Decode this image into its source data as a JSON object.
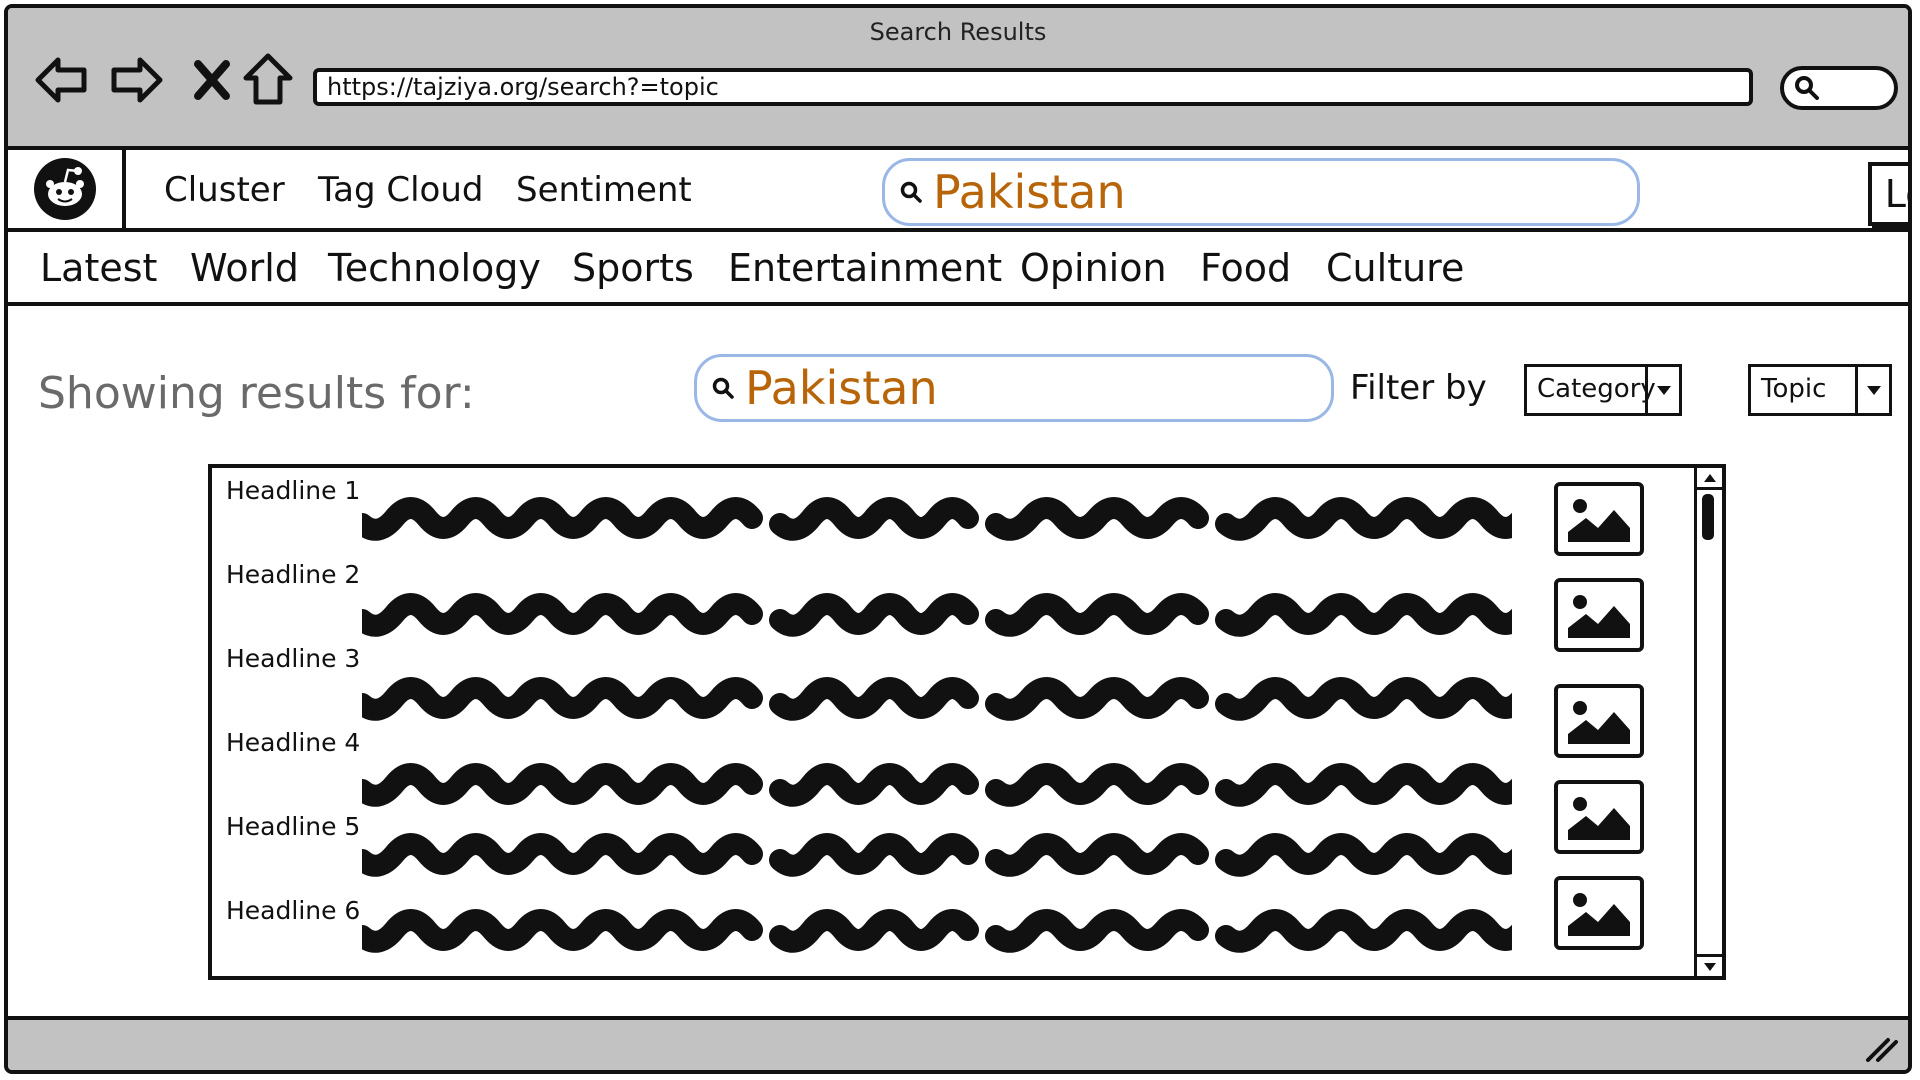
{
  "window": {
    "title": "Search Results"
  },
  "browser": {
    "url": "https://tajziya.org/search?=topic",
    "nav_icons": [
      "back-arrow-icon",
      "forward-arrow-icon",
      "close-x-icon",
      "home-icon"
    ],
    "mini_search_icon": "search-icon"
  },
  "header": {
    "logo_icon": "reddit-alien-logo",
    "links": [
      "Cluster",
      "Tag Cloud",
      "Sentiment"
    ],
    "search_value": "Pakistan",
    "login_label": "Login"
  },
  "categories": [
    "Latest",
    "World",
    "Technology",
    "Sports",
    "Entertainment",
    "Opinion",
    "Food",
    "Culture"
  ],
  "results_header": {
    "showing_label": "Showing results for:",
    "search_value": "Pakistan",
    "filter_label": "Filter by",
    "filter_category": "Category",
    "filter_topic": "Topic"
  },
  "results": {
    "headlines": [
      "Headline 1",
      "Headline 2",
      "Headline 3",
      "Headline 4",
      "Headline 5",
      "Headline 6"
    ],
    "thumbnail_icon": "image-placeholder-icon"
  },
  "colors": {
    "chrome_gray": "#c2c2c2",
    "search_text": "#b8650a",
    "search_border": "#9ab7e6",
    "muted_text": "#6a6a6a"
  }
}
